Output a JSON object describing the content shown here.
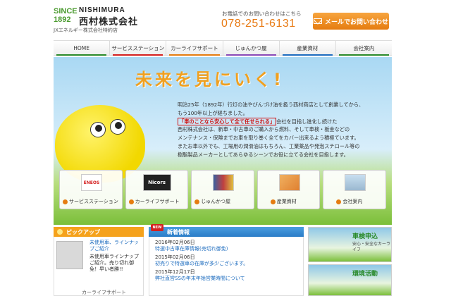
{
  "header": {
    "since": "SINCE 1892",
    "logo_en": "NISHIMURA",
    "logo_jp": "西村株式会社",
    "logo_sub": "JXエネルギー株式会社特約店",
    "contact_label": "お電話でのお問い合わせはこちら",
    "phone": "078-251-6131",
    "mail_button": "メールでお問い合わせ"
  },
  "nav": [
    {
      "label": "HOME",
      "color": "#2a8a2a"
    },
    {
      "label": "サービスステーション",
      "color": "#d42020"
    },
    {
      "label": "カーライフサポート",
      "color": "#e57c10"
    },
    {
      "label": "じゅんかつ屋",
      "color": "#8a4ab7"
    },
    {
      "label": "産業資材",
      "color": "#1d6cbf"
    },
    {
      "label": "会社案内",
      "color": "#2a8a2a"
    }
  ],
  "hero": {
    "title": "未来を見にいく!",
    "line1": "明治25年（1892年）行灯の油やびんづけ油を扱う西村商店として創業してから、",
    "line2": "もう100年以上が経ちました。",
    "highlight": "「車のことなら安心して全て任せられる」",
    "line3": "会社を目指し進化し続けた",
    "line4": "西村株式会社は、新車・中古車のご購入から燃料、そして車検・板金などの",
    "line5": "メンテナンス・保険までお車を取り巻く全てをカバー出来るよう積極ています。",
    "line6": "またお車以外でも、工場用の潤滑油はもちろん、工業薬品や発泡スチロール等の",
    "line7": "樹脂製品メーカーとしてあらゆるシーンでお役に立てる会社を目指します。"
  },
  "cards": [
    {
      "label": "サービスステーション",
      "img": "ENEOS"
    },
    {
      "label": "カーライフサポート",
      "img": "Nicors"
    },
    {
      "label": "じゅんかつ屋",
      "img": ""
    },
    {
      "label": "産業資材",
      "img": ""
    },
    {
      "label": "会社案内",
      "img": ""
    }
  ],
  "pickup": {
    "heading": "ピックアップ",
    "title": "未使用車、ラインナップご紹介",
    "desc": "未使用車ラインナップご紹介。売り切れ御免！早い者勝!!",
    "footer": "カーライフサポート"
  },
  "news": {
    "badge": "NEW",
    "heading": "新着情報",
    "items": [
      {
        "date": "2016年02月06日",
        "text": "特選中古車在庫情報(売切れ御免)"
      },
      {
        "date": "2015年02月06日",
        "text": "初売りで特選車の在庫が多少ございます。"
      },
      {
        "date": "2015年12月17日",
        "text": "弊社直営SSの年末年始営業時間について"
      }
    ]
  },
  "banners": [
    {
      "title": "車検申込",
      "sub": "安心・安全なカーライフ"
    },
    {
      "title": "環境活動",
      "sub": ""
    }
  ]
}
